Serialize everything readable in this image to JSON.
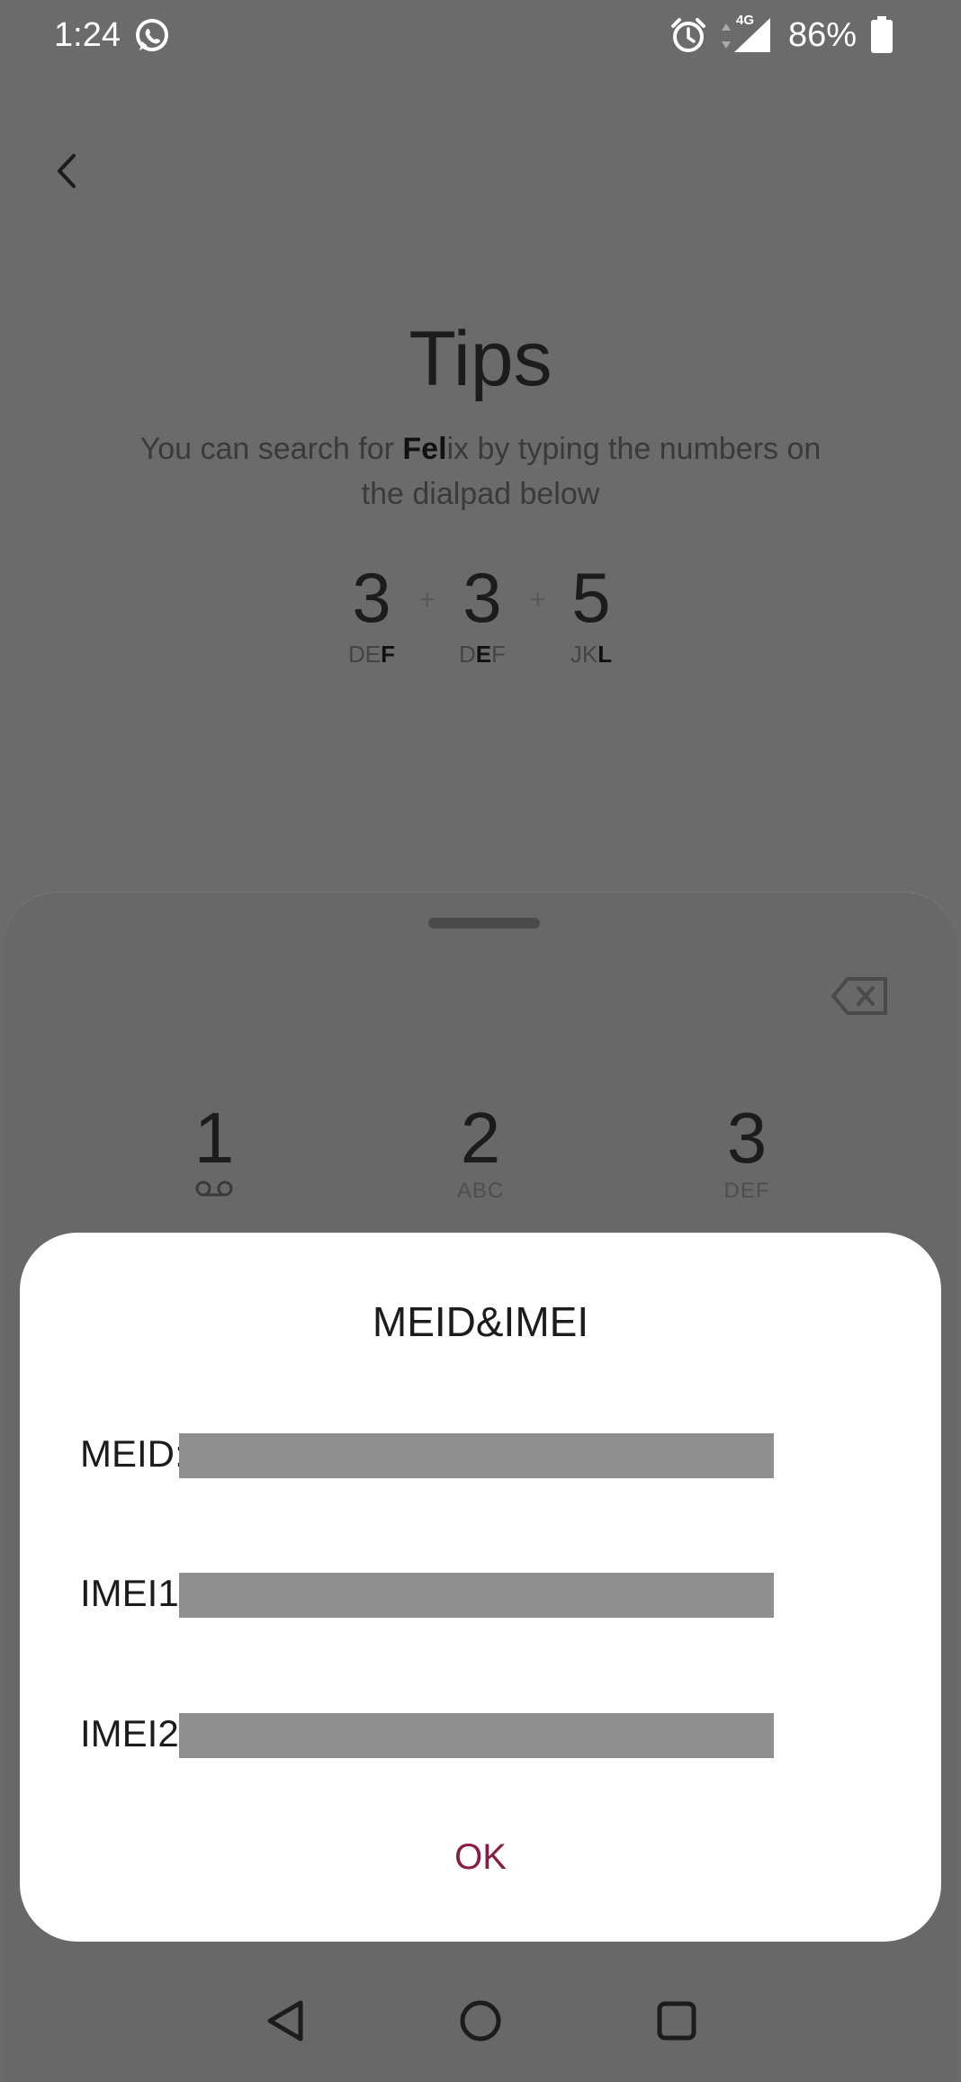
{
  "status_bar": {
    "time": "1:24",
    "network": "4G",
    "battery": "86%"
  },
  "tips": {
    "title": "Tips",
    "description_before": "You can search for ",
    "description_bold": "Fel",
    "description_after": "ix by typing the numbers on the dialpad below",
    "plus": "+",
    "digits": [
      {
        "number": "3",
        "letters_plain": "DE",
        "letters_bold": "F",
        "letters_tail": ""
      },
      {
        "number": "3",
        "letters_plain": "D",
        "letters_bold": "E",
        "letters_tail": "F"
      },
      {
        "number": "5",
        "letters_plain": "JK",
        "letters_bold": "L",
        "letters_tail": ""
      }
    ]
  },
  "dialpad": {
    "keys": [
      {
        "number": "1",
        "sub": ""
      },
      {
        "number": "2",
        "sub": "ABC"
      },
      {
        "number": "3",
        "sub": "DEF"
      }
    ]
  },
  "dialog": {
    "title": "MEID&IMEI",
    "rows": [
      {
        "label": "MEID:"
      },
      {
        "label": "IMEI1:"
      },
      {
        "label": "IMEI2:"
      }
    ],
    "ok_label": "OK"
  },
  "colors": {
    "accent": "#8a1c43",
    "scrim": "#6b6b6b",
    "redaction": "#8f8f8f"
  }
}
